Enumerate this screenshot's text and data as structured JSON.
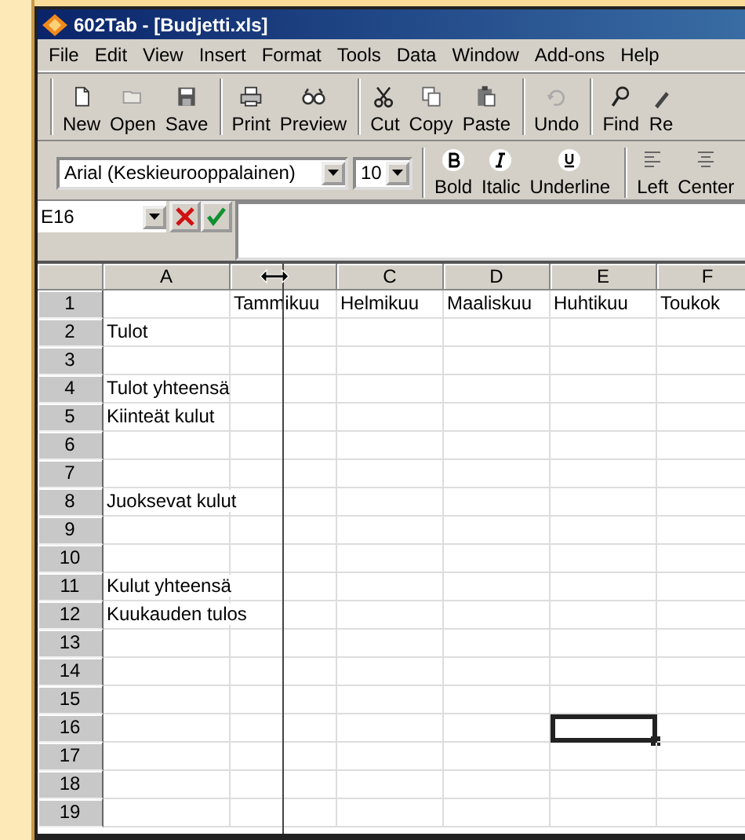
{
  "window": {
    "title": "602Tab - [Budjetti.xls]"
  },
  "menu": [
    "File",
    "Edit",
    "View",
    "Insert",
    "Format",
    "Tools",
    "Data",
    "Window",
    "Add-ons",
    "Help"
  ],
  "toolbar": [
    [
      {
        "label": "New"
      },
      {
        "label": "Open"
      },
      {
        "label": "Save"
      }
    ],
    [
      {
        "label": "Print"
      },
      {
        "label": "Preview"
      }
    ],
    [
      {
        "label": "Cut"
      },
      {
        "label": "Copy"
      },
      {
        "label": "Paste"
      }
    ],
    [
      {
        "label": "Undo"
      }
    ],
    [
      {
        "label": "Find"
      },
      {
        "label": "Re"
      }
    ]
  ],
  "format_toolbar": {
    "font": "Arial (Keskieurooppalainen)",
    "size": "10",
    "groups": [
      [
        {
          "label": "Bold"
        },
        {
          "label": "Italic"
        },
        {
          "label": "Underline"
        }
      ],
      [
        {
          "label": "Left"
        },
        {
          "label": "Center"
        }
      ]
    ]
  },
  "formula_bar": {
    "name_box": "E16"
  },
  "sheet": {
    "columns": [
      {
        "kind": "label",
        "label": "A"
      },
      {
        "kind": "resize-cursor"
      },
      {
        "kind": "label",
        "label": "C"
      },
      {
        "kind": "label",
        "label": "D"
      },
      {
        "kind": "label",
        "label": "E"
      },
      {
        "kind": "label",
        "label": "F"
      }
    ],
    "rows": [
      {
        "number": "1",
        "cells": [
          {
            "selected": false
          },
          {
            "text": "Tammikuu",
            "selected": false
          },
          {
            "text": "Helmikuu",
            "selected": false
          },
          {
            "text": "Maaliskuu",
            "selected": false
          },
          {
            "text": "Huhtikuu",
            "selected": false
          },
          {
            "text": "Toukok",
            "selected": false
          }
        ]
      },
      {
        "number": "2",
        "cells": [
          {
            "text": "Tulot",
            "selected": false
          },
          {
            "selected": false
          },
          {
            "selected": false
          },
          {
            "selected": false
          },
          {
            "selected": false
          },
          {
            "selected": false
          }
        ]
      },
      {
        "number": "3",
        "cells": [
          {
            "selected": false
          },
          {
            "selected": false
          },
          {
            "selected": false
          },
          {
            "selected": false
          },
          {
            "selected": false
          },
          {
            "selected": false
          }
        ]
      },
      {
        "number": "4",
        "cells": [
          {
            "text": "Tulot yhteensä",
            "selected": false
          },
          {
            "selected": false
          },
          {
            "selected": false
          },
          {
            "selected": false
          },
          {
            "selected": false
          },
          {
            "selected": false
          }
        ]
      },
      {
        "number": "5",
        "cells": [
          {
            "text": "Kiinteät kulut",
            "selected": false
          },
          {
            "selected": false
          },
          {
            "selected": false
          },
          {
            "selected": false
          },
          {
            "selected": false
          },
          {
            "selected": false
          }
        ]
      },
      {
        "number": "6",
        "cells": [
          {
            "selected": false
          },
          {
            "selected": false
          },
          {
            "selected": false
          },
          {
            "selected": false
          },
          {
            "selected": false
          },
          {
            "selected": false
          }
        ]
      },
      {
        "number": "7",
        "cells": [
          {
            "selected": false
          },
          {
            "selected": false
          },
          {
            "selected": false
          },
          {
            "selected": false
          },
          {
            "selected": false
          },
          {
            "selected": false
          }
        ]
      },
      {
        "number": "8",
        "cells": [
          {
            "text": "Juoksevat kulut",
            "selected": false
          },
          {
            "selected": false
          },
          {
            "selected": false
          },
          {
            "selected": false
          },
          {
            "selected": false
          },
          {
            "selected": false
          }
        ]
      },
      {
        "number": "9",
        "cells": [
          {
            "selected": false
          },
          {
            "selected": false
          },
          {
            "selected": false
          },
          {
            "selected": false
          },
          {
            "selected": false
          },
          {
            "selected": false
          }
        ]
      },
      {
        "number": "10",
        "cells": [
          {
            "selected": false
          },
          {
            "selected": false
          },
          {
            "selected": false
          },
          {
            "selected": false
          },
          {
            "selected": false
          },
          {
            "selected": false
          }
        ]
      },
      {
        "number": "11",
        "cells": [
          {
            "text": "Kulut yhteensä",
            "selected": false
          },
          {
            "selected": false
          },
          {
            "selected": false
          },
          {
            "selected": false
          },
          {
            "selected": false
          },
          {
            "selected": false
          }
        ]
      },
      {
        "number": "12",
        "cells": [
          {
            "text": "Kuukauden tulos",
            "selected": false
          },
          {
            "selected": false
          },
          {
            "selected": false
          },
          {
            "selected": false
          },
          {
            "selected": false
          },
          {
            "selected": false
          }
        ]
      },
      {
        "number": "13",
        "cells": [
          {
            "selected": false
          },
          {
            "selected": false
          },
          {
            "selected": false
          },
          {
            "selected": false
          },
          {
            "selected": false
          },
          {
            "selected": false
          }
        ]
      },
      {
        "number": "14",
        "cells": [
          {
            "selected": false
          },
          {
            "selected": false
          },
          {
            "selected": false
          },
          {
            "selected": false
          },
          {
            "selected": false
          },
          {
            "selected": false
          }
        ]
      },
      {
        "number": "15",
        "cells": [
          {
            "selected": false
          },
          {
            "selected": false
          },
          {
            "selected": false
          },
          {
            "selected": false
          },
          {
            "selected": false
          },
          {
            "selected": false
          }
        ]
      },
      {
        "number": "16",
        "cells": [
          {
            "selected": false
          },
          {
            "selected": false
          },
          {
            "selected": false
          },
          {
            "selected": false
          },
          {
            "selected": true
          },
          {
            "selected": false
          }
        ]
      },
      {
        "number": "17",
        "cells": [
          {
            "selected": false
          },
          {
            "selected": false
          },
          {
            "selected": false
          },
          {
            "selected": false
          },
          {
            "selected": false
          },
          {
            "selected": false
          }
        ]
      },
      {
        "number": "18",
        "cells": [
          {
            "selected": false
          },
          {
            "selected": false
          },
          {
            "selected": false
          },
          {
            "selected": false
          },
          {
            "selected": false
          },
          {
            "selected": false
          }
        ]
      },
      {
        "number": "19",
        "cells": [
          {
            "selected": false
          },
          {
            "selected": false
          },
          {
            "selected": false
          },
          {
            "selected": false
          },
          {
            "selected": false
          },
          {
            "selected": false
          }
        ]
      }
    ]
  }
}
